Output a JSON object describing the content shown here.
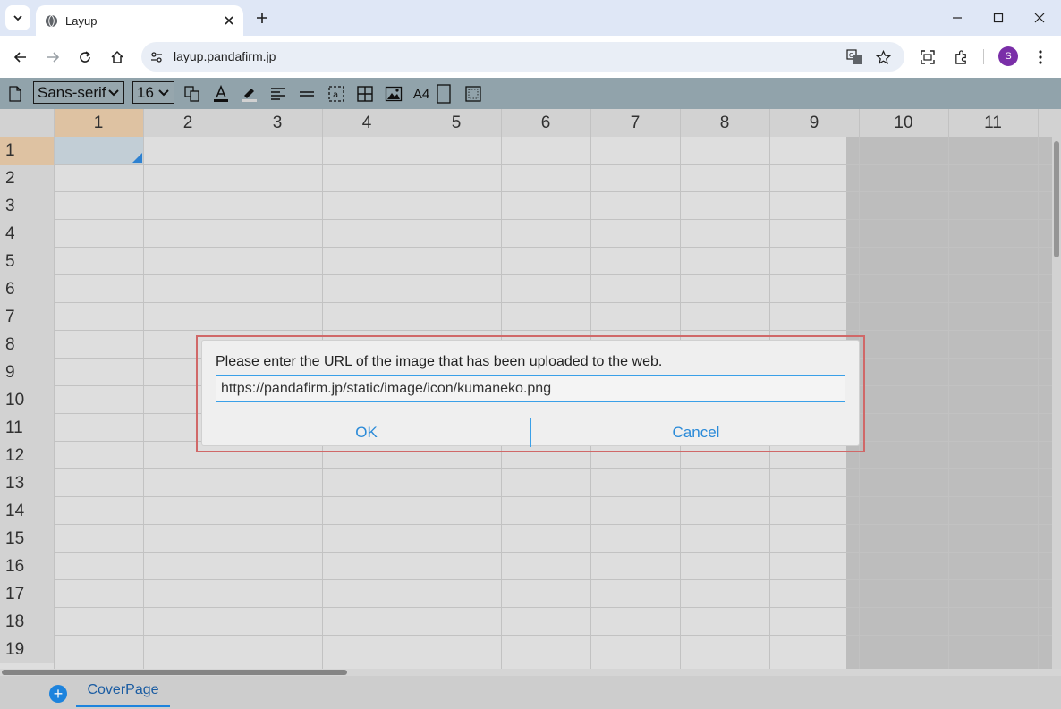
{
  "browser": {
    "tab_title": "Layup",
    "url": "layup.pandafirm.jp",
    "profile_initial": "S"
  },
  "app_toolbar": {
    "font_family": "Sans-serif",
    "font_size": "16",
    "paper_size": "A4"
  },
  "grid": {
    "columns": [
      "1",
      "2",
      "3",
      "4",
      "5",
      "6",
      "7",
      "8",
      "9",
      "10",
      "11"
    ],
    "rows": [
      "1",
      "2",
      "3",
      "4",
      "5",
      "6",
      "7",
      "8",
      "9",
      "10",
      "11",
      "12",
      "13",
      "14",
      "15",
      "16",
      "17",
      "18",
      "19"
    ]
  },
  "sheets": {
    "add_label": "+",
    "tabs": [
      "CoverPage"
    ]
  },
  "dialog": {
    "message": "Please enter the URL of the image that has been uploaded to the web.",
    "input_value": "https://pandafirm.jp/static/image/icon/kumaneko.png",
    "ok_label": "OK",
    "cancel_label": "Cancel"
  },
  "colors": {
    "accent": "#1e88e5",
    "highlight_outline": "#d06868",
    "toolbar_bg": "#96a9b1"
  }
}
